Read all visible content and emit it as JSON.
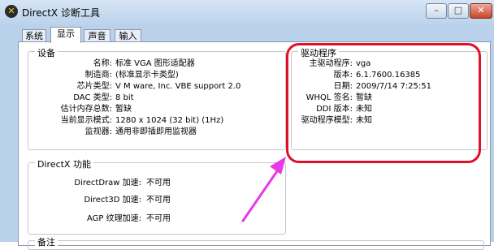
{
  "window": {
    "title": "DirectX 诊断工具",
    "buttons": {
      "minimize": "–",
      "maximize": "□",
      "close": "✕"
    }
  },
  "tabs": [
    {
      "label": "系统"
    },
    {
      "label": "显示",
      "active": true
    },
    {
      "label": "声音"
    },
    {
      "label": "输入"
    }
  ],
  "device": {
    "legend": "设备",
    "rows": [
      {
        "label": "名称:",
        "value": "标准 VGA 图形适配器"
      },
      {
        "label": "制造商:",
        "value": "(标准显示卡类型)"
      },
      {
        "label": "芯片类型:",
        "value": "V M ware, Inc. VBE support 2.0"
      },
      {
        "label": "DAC 类型:",
        "value": "8 bit"
      },
      {
        "label": "估计内存总数:",
        "value": "暂缺"
      },
      {
        "label": "当前显示模式:",
        "value": "1280 x 1024 (32 bit) (1Hz)"
      },
      {
        "label": "监视器:",
        "value": "通用非即插即用监视器"
      }
    ]
  },
  "driver": {
    "legend": "驱动程序",
    "rows": [
      {
        "label": "主驱动程序:",
        "value": "vga"
      },
      {
        "label": "版本:",
        "value": "6.1.7600.16385"
      },
      {
        "label": "日期:",
        "value": "2009/7/14 7:25:51"
      },
      {
        "label": "WHQL 签名:",
        "value": "暂缺"
      },
      {
        "label": "DDI 版本:",
        "value": "未知"
      },
      {
        "label": "驱动程序模型:",
        "value": "未知"
      }
    ]
  },
  "directx": {
    "legend": "DirectX 功能",
    "rows": [
      {
        "label": "DirectDraw 加速:",
        "value": "不可用"
      },
      {
        "label": "Direct3D 加速:",
        "value": "不可用"
      },
      {
        "label": "AGP 纹理加速:",
        "value": "不可用"
      }
    ]
  },
  "notes": {
    "legend": "备注"
  },
  "annotation": {
    "box_color": "#e0102a",
    "arrow_color": "#e838e8"
  }
}
